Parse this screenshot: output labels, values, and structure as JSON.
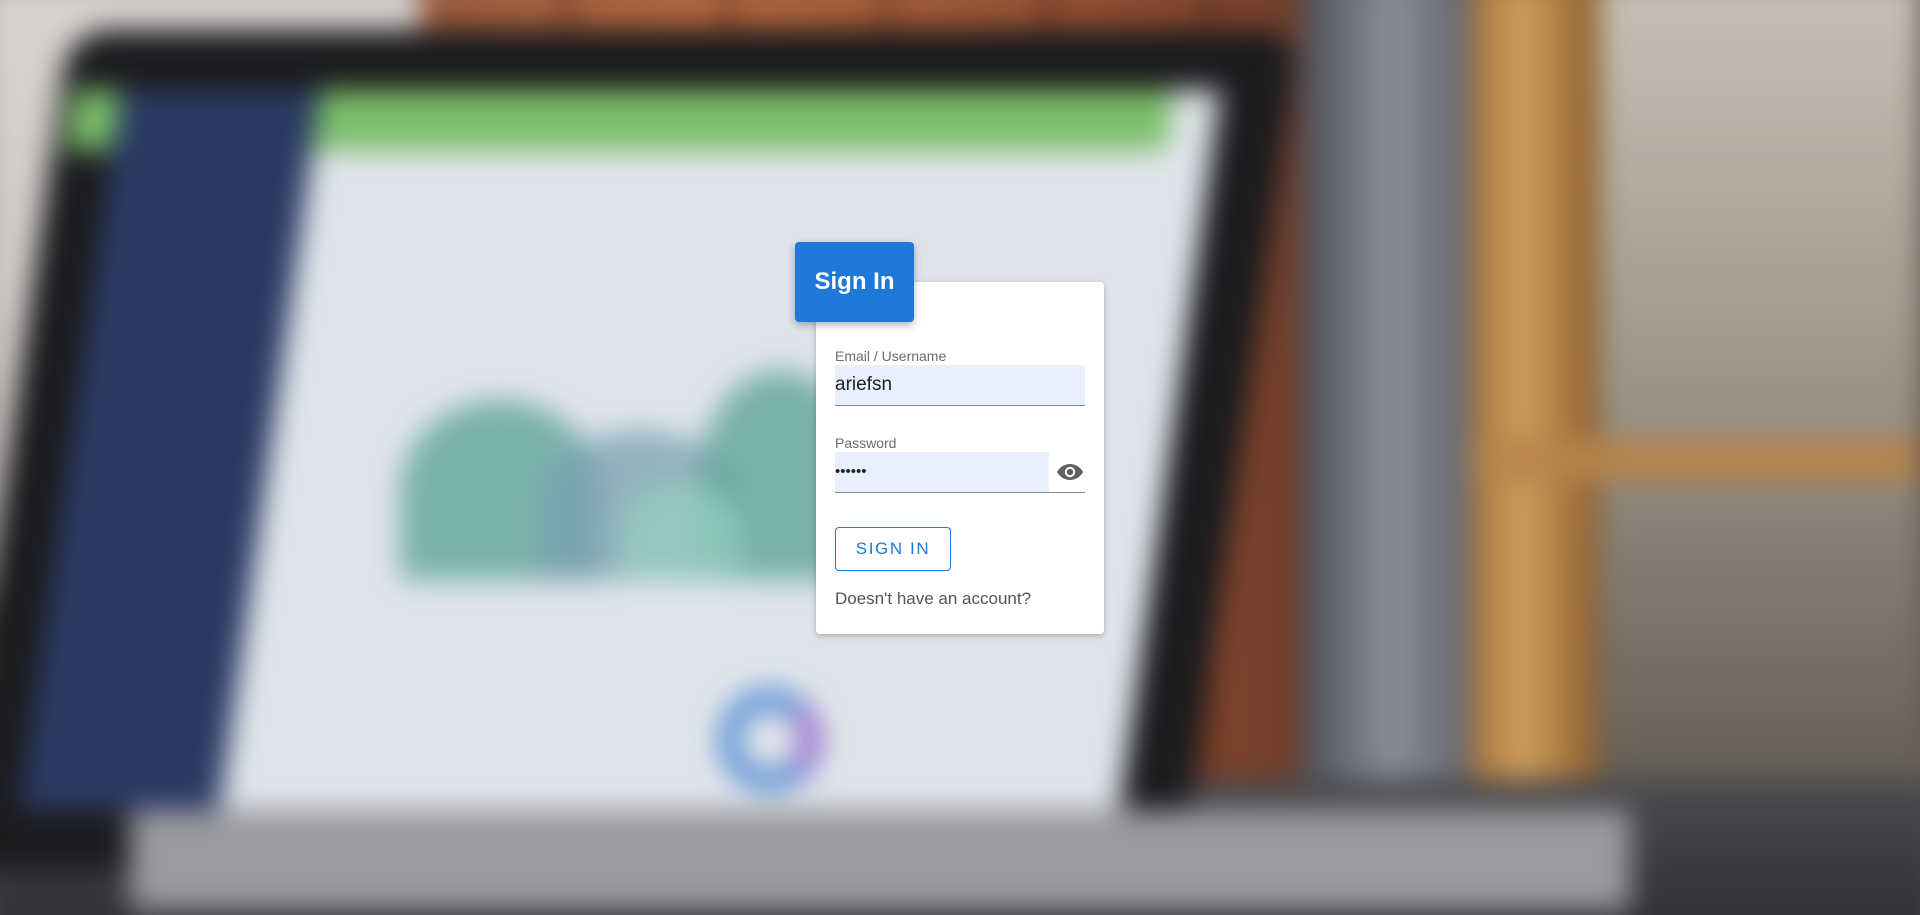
{
  "card": {
    "title": "Sign In",
    "email_label": "Email / Username",
    "email_value": "ariefsn",
    "password_label": "Password",
    "password_value": "••••••",
    "signin_button": "SIGN IN",
    "no_account_link": "Doesn't have an account?"
  },
  "colors": {
    "accent": "#1e78d8",
    "input_fill": "#e8f0fe",
    "card_bg": "#ffffff"
  },
  "icons": {
    "password_toggle": "eye-icon"
  }
}
